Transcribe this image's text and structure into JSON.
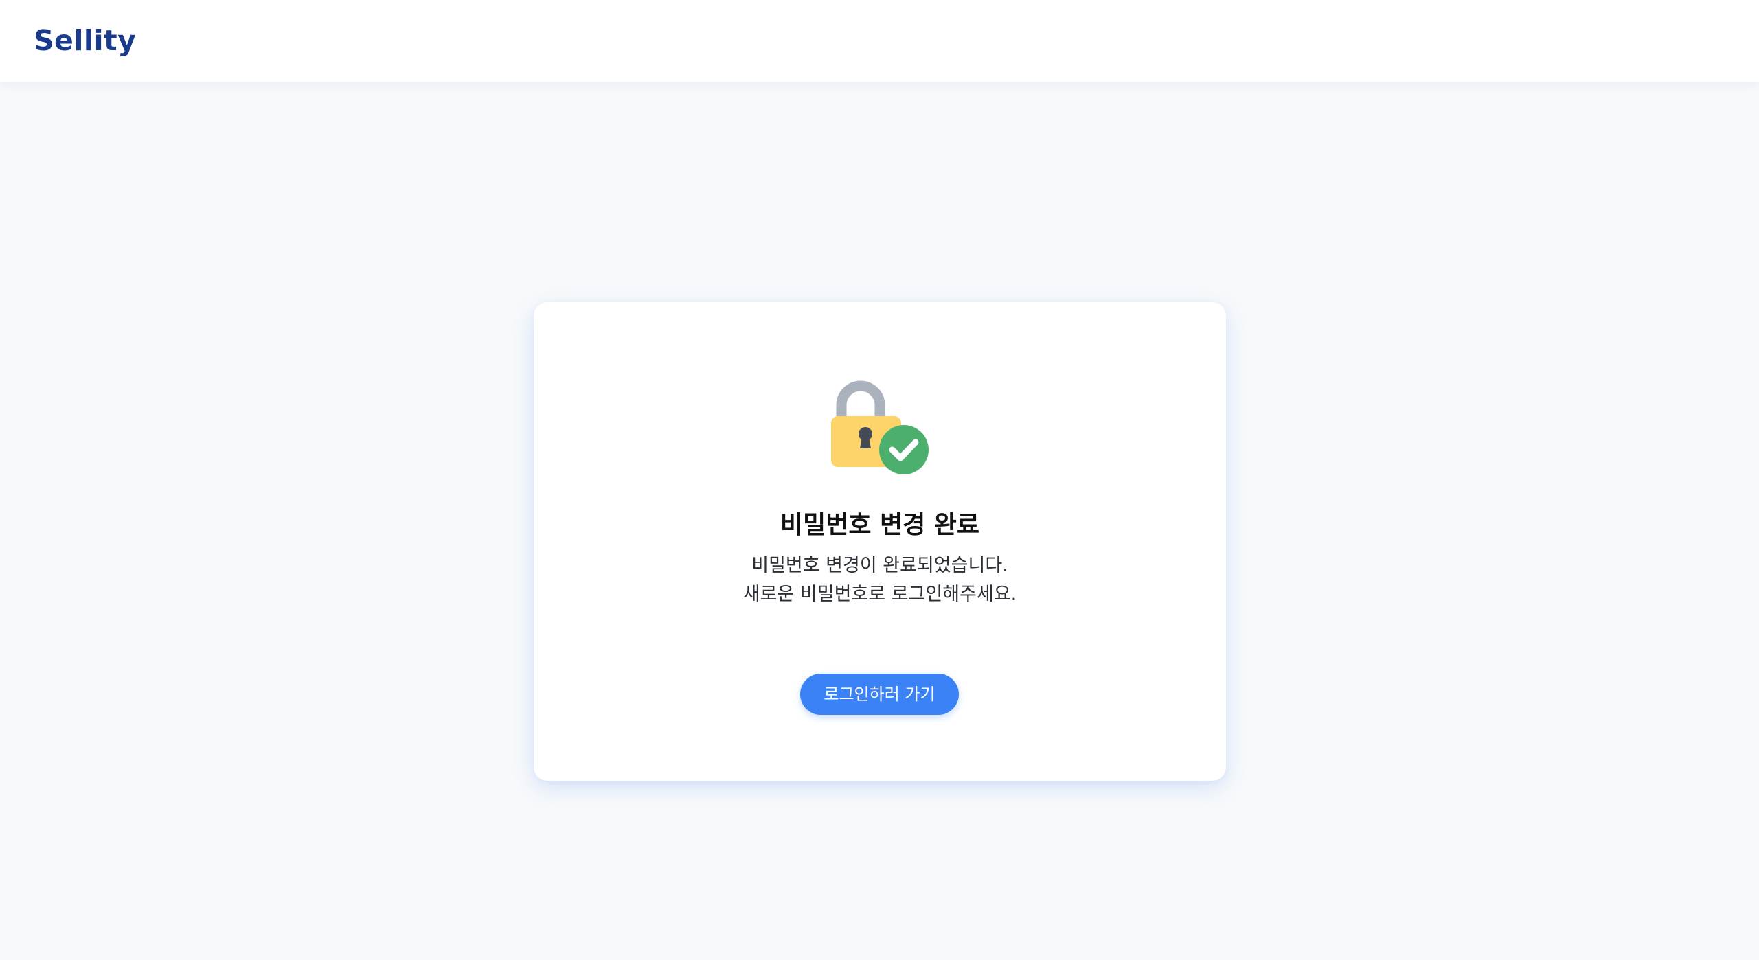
{
  "header": {
    "logo_text": "Sellity"
  },
  "card": {
    "icon": "lock-check-icon",
    "title": "비밀번호 변경 완료",
    "description_line1": "비밀번호 변경이 완료되었습니다.",
    "description_line2": "새로운 비밀번호로 로그인해주세요.",
    "button_label": "로그인하러 가기"
  },
  "colors": {
    "brand": "#1a3a8c",
    "accent": "#3b82f6",
    "background": "#f7f9fb",
    "lock_body": "#fcd469",
    "lock_shackle": "#aab2bd",
    "check_badge": "#4caf6e"
  }
}
